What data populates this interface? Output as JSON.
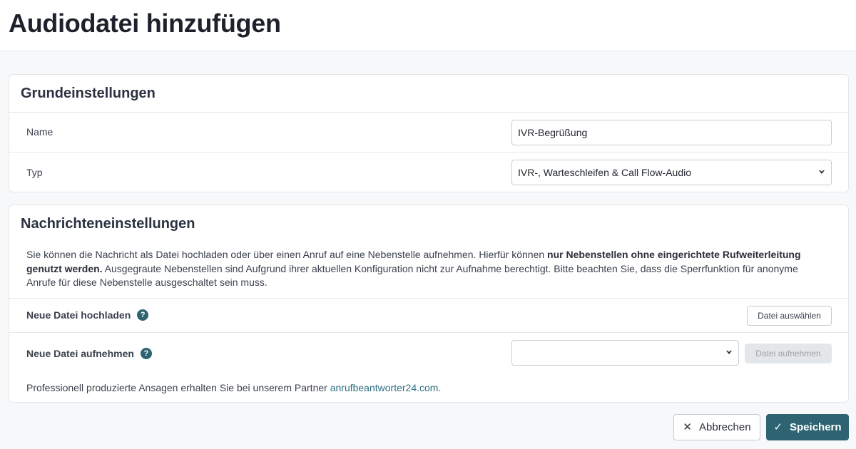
{
  "page": {
    "title": "Audiodatei hinzufügen"
  },
  "basic_settings": {
    "title": "Grundeinstellungen",
    "name_label": "Name",
    "name_value": "IVR-Begrüßung",
    "type_label": "Typ",
    "type_value": "IVR-, Warteschleifen & Call Flow-Audio"
  },
  "message_settings": {
    "title": "Nachrichteneinstellungen",
    "description_part1": "Sie können die Nachricht als Datei hochladen oder über einen Anruf auf eine Nebenstelle aufnehmen. Hierfür können ",
    "description_bold": "nur Nebenstellen ohne eingerichtete Rufweiterleitung genutzt werden.",
    "description_part2": " Ausgegraute Nebenstellen sind Aufgrund ihrer aktuellen Konfiguration nicht zur Aufnahme berechtigt. Bitte beachten Sie, dass die Sperrfunktion für anonyme Anrufe für diese Nebenstelle ausgeschaltet sein muss.",
    "upload_label": "Neue Datei hochladen",
    "upload_button": "Datei auswählen",
    "record_label": "Neue Datei aufnehmen",
    "record_select_value": "",
    "record_button": "Datei aufnehmen",
    "help_glyph": "?",
    "partner_text": "Professionell produzierte Ansagen erhalten Sie bei unserem Partner ",
    "partner_link": "anrufbeantworter24.com",
    "partner_suffix": "."
  },
  "actions": {
    "cancel_label": "Abbrechen",
    "save_label": "Speichern"
  },
  "colors": {
    "accent": "#2e6471",
    "link": "#2e6f80"
  },
  "icons": {
    "cancel": "close-icon",
    "save": "check-icon",
    "help": "help-circle-icon",
    "select": "caret-down-icon"
  }
}
